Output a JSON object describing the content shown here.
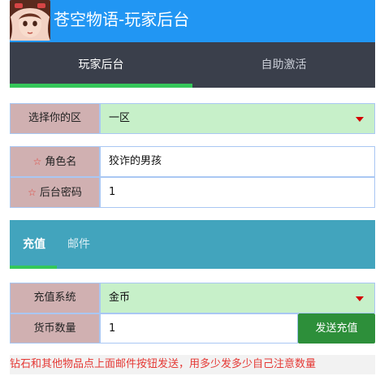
{
  "header": {
    "title": "苍空物语-玩家后台"
  },
  "main_tabs": [
    {
      "label": "玩家后台",
      "active": true
    },
    {
      "label": "自助激活",
      "active": false
    }
  ],
  "server_select": {
    "label": "选择你的区",
    "value": "一区"
  },
  "character_name": {
    "label": "角色名",
    "value": "狡诈的男孩",
    "required_marker": "☆"
  },
  "admin_password": {
    "label": "后台密码",
    "value": "1",
    "required_marker": "☆"
  },
  "sub_tabs": [
    {
      "label": "充值",
      "active": true
    },
    {
      "label": "邮件",
      "active": false
    }
  ],
  "recharge_system": {
    "label": "充值系统",
    "value": "金币"
  },
  "currency_amount": {
    "label": "货币数量",
    "value": "1"
  },
  "send_button": {
    "label": "发送充值"
  },
  "notice": "钻石和其他物品点上面邮件按钮发送，用多少发多少自己注意数量",
  "colors": {
    "header_bg": "#2196f3",
    "tab_bar_bg": "#3a3f4b",
    "sub_tab_bg": "#42a4bd",
    "active_indicator": "#34c759",
    "label_bg": "#d0b0b1",
    "select_bg": "#c7f0c9",
    "button_bg": "#2d8f3a",
    "notice_text": "#e53935"
  }
}
